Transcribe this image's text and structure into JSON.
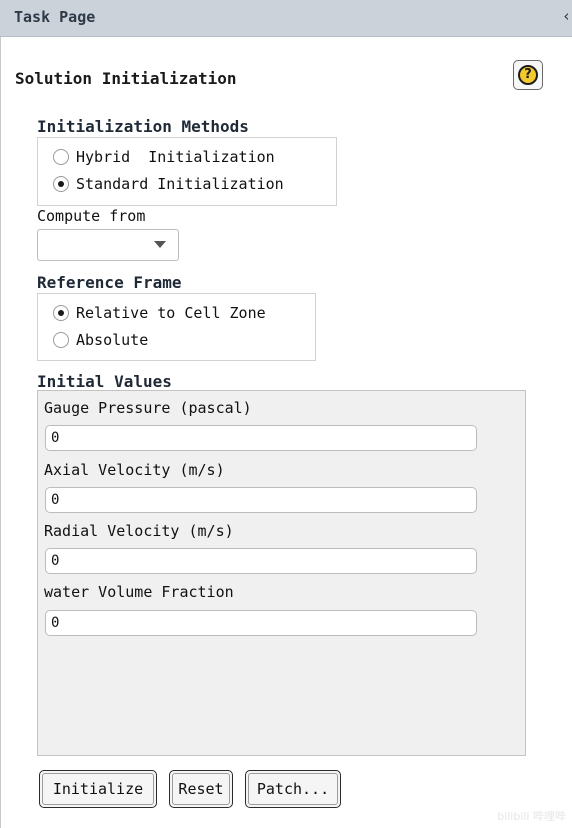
{
  "header": {
    "title": "Task Page",
    "collapse_glyph": "‹"
  },
  "section": {
    "title": "Solution Initialization",
    "help_glyph": "?"
  },
  "init_methods": {
    "label": "Initialization Methods",
    "options": [
      {
        "label": "Hybrid  Initialization",
        "checked": false
      },
      {
        "label": "Standard Initialization",
        "checked": true
      }
    ]
  },
  "compute_from": {
    "label": "Compute from",
    "value": ""
  },
  "reference_frame": {
    "label": "Reference Frame",
    "options": [
      {
        "label": "Relative to Cell Zone",
        "checked": true
      },
      {
        "label": "Absolute",
        "checked": false
      }
    ]
  },
  "initial_values": {
    "label": "Initial Values",
    "fields": [
      {
        "label": "Gauge Pressure (pascal)",
        "value": "0"
      },
      {
        "label": "Axial Velocity (m/s)",
        "value": "0"
      },
      {
        "label": "Radial Velocity (m/s)",
        "value": "0"
      },
      {
        "label": "water Volume Fraction",
        "value": "0"
      }
    ]
  },
  "buttons": {
    "initialize": "Initialize",
    "reset": "Reset",
    "patch": "Patch..."
  },
  "watermark": "bilibili 哔哩哔",
  "colors": {
    "header_bg": "#ccd2da",
    "panel_bg": "#f0f0f0",
    "help_icon": "#f4c92e"
  }
}
